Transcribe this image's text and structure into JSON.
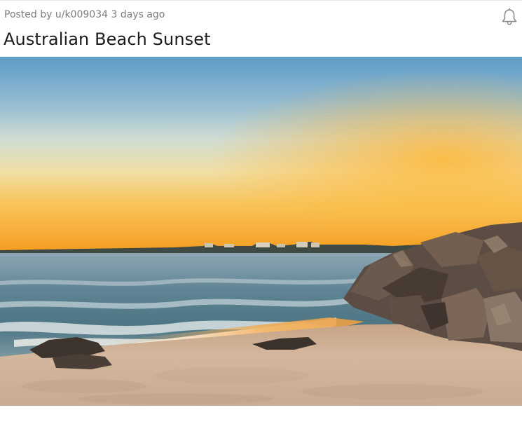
{
  "post": {
    "posted_by_prefix": "Posted by",
    "author": "u/k009034",
    "time_ago": "3 days ago",
    "title": "Australian Beach Sunset"
  },
  "icons": {
    "notify": "bell-icon"
  },
  "colors": {
    "meta_text": "#7c7c7c",
    "title_text": "#1c1c1c",
    "sky_top": "#5e9bc4",
    "horizon_glow": "#f7a826",
    "sand": "#c9a98a"
  }
}
